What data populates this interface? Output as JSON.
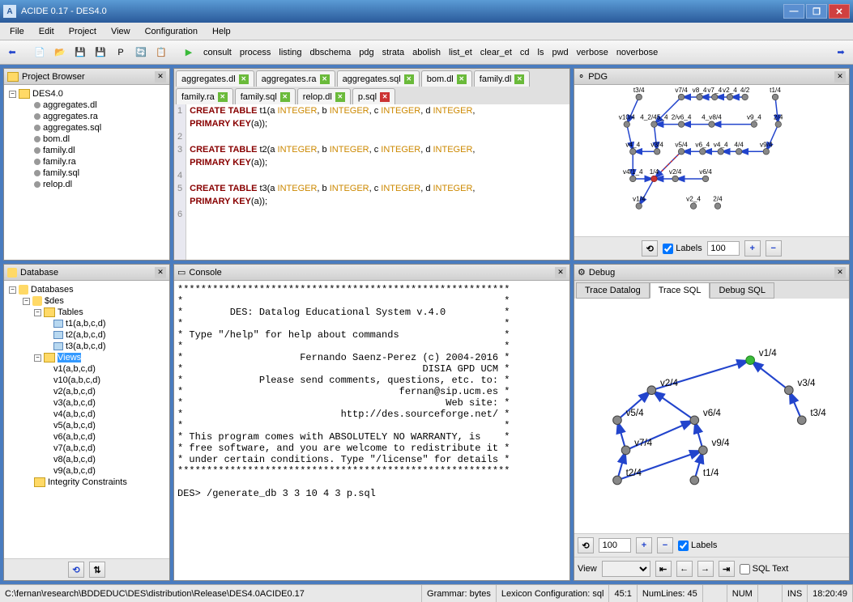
{
  "title": "ACIDE 0.17 - DES4.0",
  "menus": [
    "File",
    "Edit",
    "Project",
    "View",
    "Configuration",
    "Help"
  ],
  "commands": [
    "consult",
    "process",
    "listing",
    "dbschema",
    "pdg",
    "strata",
    "abolish",
    "list_et",
    "clear_et",
    "cd",
    "ls",
    "pwd",
    "verbose",
    "noverbose"
  ],
  "projectBrowser": {
    "title": "Project Browser",
    "root": "DES4.0",
    "files": [
      "aggregates.dl",
      "aggregates.ra",
      "aggregates.sql",
      "bom.dl",
      "family.dl",
      "family.ra",
      "family.sql",
      "relop.dl"
    ]
  },
  "editorTabs": [
    {
      "name": "aggregates.dl",
      "close": "g"
    },
    {
      "name": "aggregates.ra",
      "close": "g"
    },
    {
      "name": "aggregates.sql",
      "close": "g"
    },
    {
      "name": "bom.dl",
      "close": "g"
    },
    {
      "name": "family.dl",
      "close": "g"
    },
    {
      "name": "family.ra",
      "close": "g"
    },
    {
      "name": "family.sql",
      "close": "g"
    },
    {
      "name": "relop.dl",
      "close": "g"
    },
    {
      "name": "p.sql",
      "close": "r"
    }
  ],
  "code": {
    "lines": [
      [
        "CREATE TABLE",
        " t1(a ",
        "INTEGER",
        ", b ",
        "INTEGER",
        ", c ",
        "INTEGER",
        ", d ",
        "INTEGER",
        ","
      ],
      [
        "PRIMARY KEY",
        "(a));"
      ],
      [
        ""
      ],
      [
        "CREATE TABLE",
        " t2(a ",
        "INTEGER",
        ", b ",
        "INTEGER",
        ", c ",
        "INTEGER",
        ", d ",
        "INTEGER",
        ","
      ],
      [
        "PRIMARY KEY",
        "(a));"
      ],
      [
        ""
      ],
      [
        "CREATE TABLE",
        " t3(a ",
        "INTEGER",
        ", b ",
        "INTEGER",
        ", c ",
        "INTEGER",
        ", d ",
        "INTEGER",
        ","
      ],
      [
        "PRIMARY KEY",
        "(a));"
      ]
    ],
    "lineNums": [
      "1",
      "",
      "2",
      "3",
      "",
      "4",
      "5",
      "",
      "6"
    ]
  },
  "database": {
    "title": "Database",
    "root": "Databases",
    "schema": "$des",
    "tablesLabel": "Tables",
    "tables": [
      "t1(a,b,c,d)",
      "t2(a,b,c,d)",
      "t3(a,b,c,d)"
    ],
    "viewsLabel": "Views",
    "views": [
      "v1(a,b,c,d)",
      "v10(a,b,c,d)",
      "v2(a,b,c,d)",
      "v3(a,b,c,d)",
      "v4(a,b,c,d)",
      "v5(a,b,c,d)",
      "v6(a,b,c,d)",
      "v7(a,b,c,d)",
      "v8(a,b,c,d)",
      "v9(a,b,c,d)"
    ],
    "integrityLabel": "Integrity Constraints"
  },
  "console": {
    "title": "Console",
    "text": "*********************************************************\n*                                                       *\n*        DES: Datalog Educational System v.4.0          *\n*                                                       *\n* Type \"/help\" for help about commands                  *\n*                                                       *\n*                    Fernando Saenz-Perez (c) 2004-2016 *\n*                                         DISIA GPD UCM *\n*             Please send comments, questions, etc. to: *\n*                                     fernan@sip.ucm.es *\n*                                             Web site: *\n*                           http://des.sourceforge.net/ *\n*                                                       *\n* This program comes with ABSOLUTELY NO WARRANTY, is    *\n* free software, and you are welcome to redistribute it *\n* under certain conditions. Type \"/license\" for details *\n*********************************************************\n\nDES> /generate_db 3 3 10 4 3 p.sql"
  },
  "pdg": {
    "title": "PDG",
    "labelsChk": true,
    "zoom": "100",
    "nodes": [
      "t3/4",
      "v7/4",
      "v8_4",
      "v7_4",
      "v2_4",
      "4/2",
      "t1/4",
      "v10/4",
      "4_2/45_4",
      "2/v6_4",
      "4_v8/4",
      "v9_4",
      "2/4",
      "v4_4",
      "v3/4",
      "v5/4",
      "v6_4",
      "v4_4",
      "4/4",
      "v9/4",
      "v4/1_4",
      "1/4",
      "v2/4",
      "v6/4",
      "v1/4",
      "v2_4",
      "2/4"
    ]
  },
  "debug": {
    "title": "Debug",
    "tabs": [
      "Trace Datalog",
      "Trace SQL",
      "Debug SQL"
    ],
    "activeTab": 1,
    "zoom": "100",
    "labelsChk": true,
    "viewLabel": "View",
    "sqlTextLabel": "SQL Text",
    "nodes": [
      "v1/4",
      "v2/4",
      "v3/4",
      "v5/4",
      "v6/4",
      "t3/4",
      "v7/4",
      "v9/4",
      "t2/4",
      "t1/4"
    ]
  },
  "status": {
    "path": "C:\\fernan\\research\\BDDEDUC\\DES\\distribution\\Release\\DES4.0ACIDE0.17",
    "grammar": "Grammar: bytes",
    "lexicon": "Lexicon Configuration: sql",
    "pos": "45:1",
    "numlines": "NumLines: 45",
    "num": "NUM",
    "ins": "INS",
    "time": "18:20:49"
  },
  "labels": {
    "labels": "Labels",
    "view": "View",
    "sqltext": "SQL Text"
  }
}
